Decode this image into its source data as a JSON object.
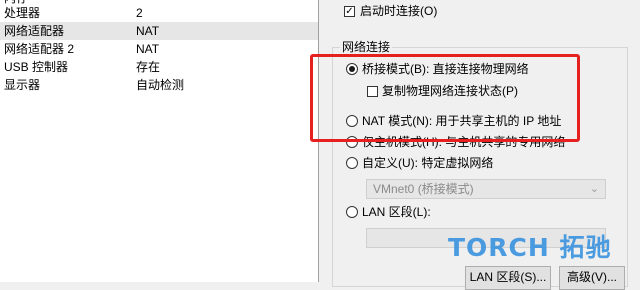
{
  "devices": {
    "cut_top_label": "内存",
    "rows": [
      {
        "name": "处理器",
        "value": "2",
        "selected": false
      },
      {
        "name": "网络适配器",
        "value": "NAT",
        "selected": true
      },
      {
        "name": "网络适配器 2",
        "value": "NAT",
        "selected": false
      },
      {
        "name": "USB 控制器",
        "value": "存在",
        "selected": false
      },
      {
        "name": "显示器",
        "value": "自动检测",
        "selected": false
      }
    ]
  },
  "device_status": {
    "connect_at_power_on_label": "启动时连接(O)",
    "connect_at_power_on_checked": true
  },
  "network_connection": {
    "group_title": "网络连接",
    "bridged_label": "桥接模式(B): 直接连接物理网络",
    "replicate_label": "复制物理网络连接状态(P)",
    "nat_label": "NAT 模式(N): 用于共享主机的 IP 地址",
    "hostonly_label": "仅主机模式(H): 与主机共享的专用网络",
    "custom_label": "自定义(U): 特定虚拟网络",
    "custom_select_value": "VMnet0 (桥接模式)",
    "lan_label": "LAN 区段(L):",
    "lan_field_value": "",
    "selected_mode": "bridged",
    "replicate_checked": false
  },
  "buttons": {
    "lan_segments_label": "LAN 区段(S)...",
    "advanced_label": "高级(V)..."
  },
  "watermark": {
    "text": "TORCH 拓驰"
  },
  "colors": {
    "highlight_box": "#e5201f",
    "watermark": "#3a92df"
  }
}
